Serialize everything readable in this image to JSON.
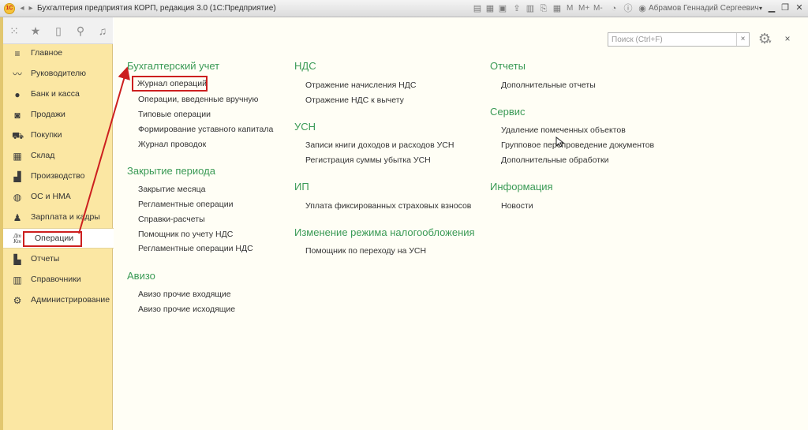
{
  "titlebar": {
    "app_logo": "1С",
    "title": "Бухгалтерия предприятия КОРП, редакция 3.0  (1С:Предприятие)",
    "m_label": "M",
    "m_plus_label": "M+",
    "m_minus_label": "M-",
    "user": "Абрамов Геннадий Сергеевич"
  },
  "sections": [
    {
      "label": "Главное",
      "icon": "menu-lines-icon"
    },
    {
      "label": "Руководителю",
      "icon": "trend-icon"
    },
    {
      "label": "Банк и касса",
      "icon": "coin-icon"
    },
    {
      "label": "Продажи",
      "icon": "bag-icon"
    },
    {
      "label": "Покупки",
      "icon": "cart-icon"
    },
    {
      "label": "Склад",
      "icon": "warehouse-icon"
    },
    {
      "label": "Производство",
      "icon": "factory-icon"
    },
    {
      "label": "ОС и НМА",
      "icon": "asset-icon"
    },
    {
      "label": "Зарплата и кадры",
      "icon": "person-icon"
    },
    {
      "label": "Операции",
      "icon": "dt-kt-icon",
      "active": true
    },
    {
      "label": "Отчеты",
      "icon": "bar-chart-icon"
    },
    {
      "label": "Справочники",
      "icon": "books-icon"
    },
    {
      "label": "Администрирование",
      "icon": "gear-icon"
    }
  ],
  "search": {
    "placeholder": "Поиск (Ctrl+F)",
    "clear_label": "×"
  },
  "close_label": "×",
  "groups": {
    "buh": {
      "title": "Бухгалтерский учет",
      "items": [
        "Журнал операций",
        "Операции, введенные вручную",
        "Типовые операции",
        "Формирование уставного капитала",
        "Журнал проводок"
      ]
    },
    "closing": {
      "title": "Закрытие периода",
      "items": [
        "Закрытие месяца",
        "Регламентные операции",
        "Справки-расчеты",
        "Помощник по учету НДС",
        "Регламентные операции НДС"
      ]
    },
    "aviso": {
      "title": "Авизо",
      "items": [
        "Авизо прочие входящие",
        "Авизо прочие исходящие"
      ]
    },
    "nds": {
      "title": "НДС",
      "items": [
        "Отражение начисления НДС",
        "Отражение НДС к вычету"
      ]
    },
    "usn": {
      "title": "УСН",
      "items": [
        "Записи книги доходов и расходов УСН",
        "Регистрация суммы убытка УСН"
      ]
    },
    "ip": {
      "title": "ИП",
      "items": [
        "Уплата фиксированных страховых взносов"
      ]
    },
    "regime": {
      "title": "Изменение режима налогообложения",
      "items": [
        "Помощник по переходу на УСН"
      ]
    },
    "reports": {
      "title": "Отчеты",
      "items": [
        "Дополнительные отчеты"
      ]
    },
    "service": {
      "title": "Сервис",
      "items": [
        "Удаление помеченных объектов",
        "Групповое перепроведение документов",
        "Дополнительные обработки"
      ]
    },
    "info": {
      "title": "Информация",
      "items": [
        "Новости"
      ]
    }
  },
  "colors": {
    "accent_green": "#3a9a55",
    "highlight_red": "#cc1f1f",
    "panel_yellow": "#fbe7a3"
  }
}
